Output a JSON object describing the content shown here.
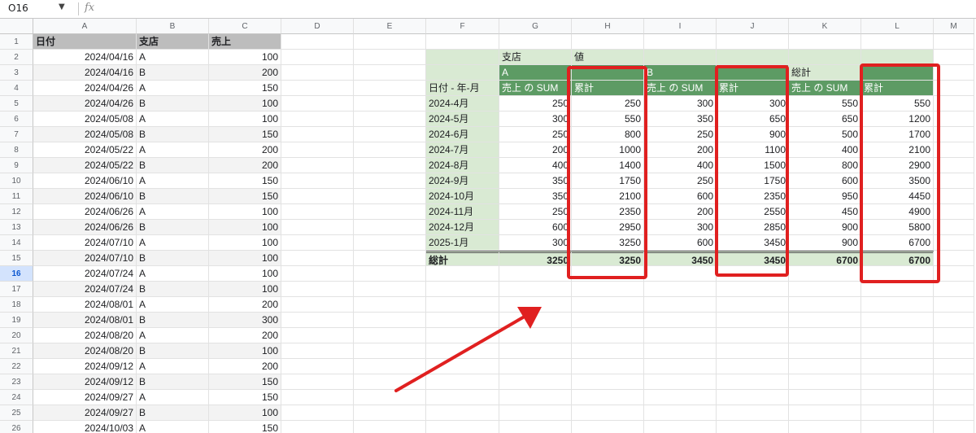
{
  "formula_bar": {
    "cell_ref": "O16",
    "fx_label": "fx",
    "formula": ""
  },
  "selected_row": "16",
  "columns": [
    "A",
    "B",
    "C",
    "D",
    "E",
    "F",
    "G",
    "H",
    "I",
    "J",
    "K",
    "L",
    "M"
  ],
  "row_numbers": [
    "1",
    "2",
    "3",
    "4",
    "5",
    "6",
    "7",
    "8",
    "9",
    "10",
    "11",
    "12",
    "13",
    "14",
    "15",
    "16",
    "17",
    "18",
    "19",
    "20",
    "21",
    "22",
    "23",
    "24",
    "25",
    "26"
  ],
  "source_table": {
    "headers": [
      "日付",
      "支店",
      "売上"
    ],
    "rows": [
      [
        "2024/04/16",
        "A",
        "100"
      ],
      [
        "2024/04/16",
        "B",
        "200"
      ],
      [
        "2024/04/26",
        "A",
        "150"
      ],
      [
        "2024/04/26",
        "B",
        "100"
      ],
      [
        "2024/05/08",
        "A",
        "100"
      ],
      [
        "2024/05/08",
        "B",
        "150"
      ],
      [
        "2024/05/22",
        "A",
        "200"
      ],
      [
        "2024/05/22",
        "B",
        "200"
      ],
      [
        "2024/06/10",
        "A",
        "150"
      ],
      [
        "2024/06/10",
        "B",
        "150"
      ],
      [
        "2024/06/26",
        "A",
        "100"
      ],
      [
        "2024/06/26",
        "B",
        "100"
      ],
      [
        "2024/07/10",
        "A",
        "100"
      ],
      [
        "2024/07/10",
        "B",
        "100"
      ],
      [
        "2024/07/24",
        "A",
        "100"
      ],
      [
        "2024/07/24",
        "B",
        "100"
      ],
      [
        "2024/08/01",
        "A",
        "200"
      ],
      [
        "2024/08/01",
        "B",
        "300"
      ],
      [
        "2024/08/20",
        "A",
        "200"
      ],
      [
        "2024/08/20",
        "B",
        "100"
      ],
      [
        "2024/09/12",
        "A",
        "200"
      ],
      [
        "2024/09/12",
        "B",
        "150"
      ],
      [
        "2024/09/27",
        "A",
        "150"
      ],
      [
        "2024/09/27",
        "B",
        "100"
      ],
      [
        "2024/10/03",
        "A",
        "150"
      ]
    ]
  },
  "pivot": {
    "branch_label": "支店",
    "values_label": "値",
    "groups": [
      "A",
      "B",
      "総計"
    ],
    "row_header": "日付 - 年-月",
    "sum_label": "売上 の SUM",
    "cumulative_label": "累計",
    "rows": [
      {
        "month": "2024-4月",
        "a_sum": "250",
        "a_cum": "250",
        "b_sum": "300",
        "b_cum": "300",
        "t_sum": "550",
        "t_cum": "550"
      },
      {
        "month": "2024-5月",
        "a_sum": "300",
        "a_cum": "550",
        "b_sum": "350",
        "b_cum": "650",
        "t_sum": "650",
        "t_cum": "1200"
      },
      {
        "month": "2024-6月",
        "a_sum": "250",
        "a_cum": "800",
        "b_sum": "250",
        "b_cum": "900",
        "t_sum": "500",
        "t_cum": "1700"
      },
      {
        "month": "2024-7月",
        "a_sum": "200",
        "a_cum": "1000",
        "b_sum": "200",
        "b_cum": "1100",
        "t_sum": "400",
        "t_cum": "2100"
      },
      {
        "month": "2024-8月",
        "a_sum": "400",
        "a_cum": "1400",
        "b_sum": "400",
        "b_cum": "1500",
        "t_sum": "800",
        "t_cum": "2900"
      },
      {
        "month": "2024-9月",
        "a_sum": "350",
        "a_cum": "1750",
        "b_sum": "250",
        "b_cum": "1750",
        "t_sum": "600",
        "t_cum": "3500"
      },
      {
        "month": "2024-10月",
        "a_sum": "350",
        "a_cum": "2100",
        "b_sum": "600",
        "b_cum": "2350",
        "t_sum": "950",
        "t_cum": "4450"
      },
      {
        "month": "2024-11月",
        "a_sum": "250",
        "a_cum": "2350",
        "b_sum": "200",
        "b_cum": "2550",
        "t_sum": "450",
        "t_cum": "4900"
      },
      {
        "month": "2024-12月",
        "a_sum": "600",
        "a_cum": "2950",
        "b_sum": "300",
        "b_cum": "2850",
        "t_sum": "900",
        "t_cum": "5800"
      },
      {
        "month": "2025-1月",
        "a_sum": "300",
        "a_cum": "3250",
        "b_sum": "600",
        "b_cum": "3450",
        "t_sum": "900",
        "t_cum": "6700"
      }
    ],
    "total_label": "総計",
    "total": {
      "a_sum": "3250",
      "a_cum": "3250",
      "b_sum": "3450",
      "b_cum": "3450",
      "t_sum": "6700",
      "t_cum": "6700"
    }
  },
  "colors": {
    "pivot_light": "#d9ead3",
    "pivot_dark": "#5d9b64",
    "highlight_red": "#e02020",
    "header_gray": "#bdbdbd",
    "band_gray": "#f3f3f3"
  }
}
